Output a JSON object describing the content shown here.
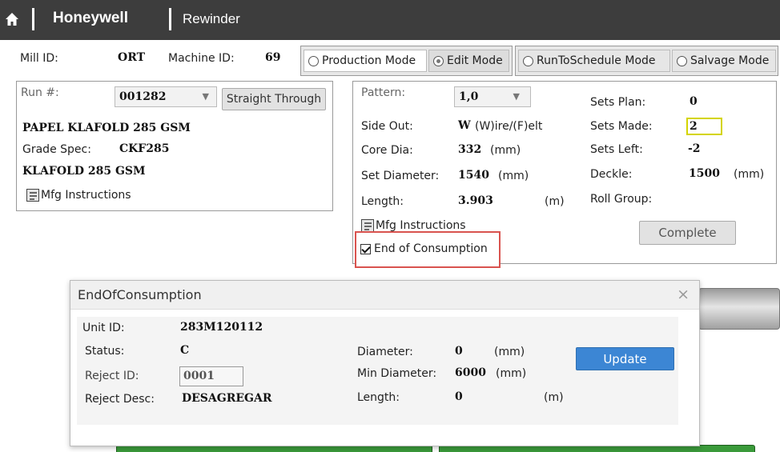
{
  "header": {
    "brand": "Honeywell",
    "app": "Rewinder",
    "home_icon": "home-icon"
  },
  "info": {
    "mill_label": "Mill ID:",
    "mill_value": "ORT",
    "machine_label": "Machine ID:",
    "machine_value": "69"
  },
  "modes": [
    {
      "label": "Production Mode",
      "selected": false
    },
    {
      "label": "Edit Mode",
      "selected": true
    },
    {
      "label": "RunToSchedule Mode",
      "selected": false
    },
    {
      "label": "Salvage Mode",
      "selected": false
    }
  ],
  "run": {
    "run_label": "Run #:",
    "run_value": "001282",
    "straight_through": "Straight Through",
    "grade_name": "PAPEL KLAFOLD 285 GSM",
    "grade_spec_label": "Grade Spec:",
    "grade_spec_value": "CKF285",
    "grade_desc": "KLAFOLD 285 GSM",
    "mfg_instructions": "Mfg Instructions"
  },
  "pattern": {
    "pattern_label": "Pattern:",
    "pattern_value": "1,0",
    "side_out_label": "Side Out:",
    "side_out_value": "W",
    "side_out_hint": "(W)ire/(F)elt",
    "core_dia_label": "Core Dia:",
    "core_dia_value": "332",
    "core_dia_unit": "(mm)",
    "set_diameter_label": "Set Diameter:",
    "set_diameter_value": "1540",
    "set_diameter_unit": "(mm)",
    "length_label": "Length:",
    "length_value": "3.903",
    "length_unit": "(m)",
    "sets_plan_label": "Sets Plan:",
    "sets_plan_value": "0",
    "sets_made_label": "Sets Made:",
    "sets_made_value": "2",
    "sets_left_label": "Sets Left:",
    "sets_left_value": "-2",
    "deckle_label": "Deckle:",
    "deckle_value": "1500",
    "deckle_unit": "(mm)",
    "roll_group_label": "Roll Group:",
    "mfg_instructions": "Mfg Instructions",
    "complete": "Complete",
    "end_of_consumption": "End of Consumption"
  },
  "dialog": {
    "title": "EndOfConsumption",
    "close": "×",
    "unit_id_label": "Unit ID:",
    "unit_id_value": "283M120112",
    "status_label": "Status:",
    "status_value": "C",
    "reject_id_label": "Reject ID:",
    "reject_id_value": "0001",
    "reject_desc_label": "Reject Desc:",
    "reject_desc_value": "DESAGREGAR",
    "diameter_label": "Diameter:",
    "diameter_value": "0",
    "diameter_unit": "(mm)",
    "min_diameter_label": "Min Diameter:",
    "min_diameter_value": "6000",
    "min_diameter_unit": "(mm)",
    "length_label": "Length:",
    "length_value": "0",
    "length_unit": "(m)",
    "update": "Update"
  },
  "colors": {
    "header_bg": "#3d3d3d",
    "highlight_red": "#d9534f",
    "sets_made_border": "#d4d400",
    "update_blue": "#3c86d4",
    "roll_green": "#3a9a3a"
  }
}
